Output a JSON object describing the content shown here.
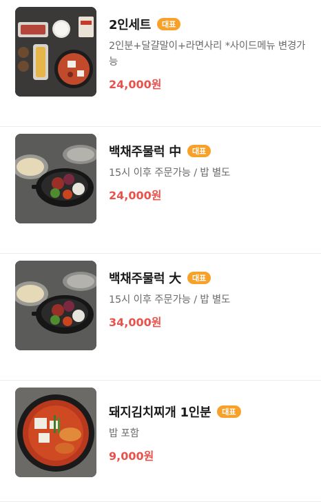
{
  "menu": {
    "items": [
      {
        "name": "2인세트",
        "badge": "대표",
        "description": "2인분+달걀말이+라면사리 *사이드메뉴 변경가능",
        "price": "24,000원",
        "image_icon": "jjigae-set-photo"
      },
      {
        "name": "백채주물럭 中",
        "badge": "대표",
        "description": "15시 이후 주문가능 / 밥 별도",
        "price": "24,000원",
        "image_icon": "jumulleok-pan-photo"
      },
      {
        "name": "백채주물럭 大",
        "badge": "대표",
        "description": "15시 이후 주문가능 / 밥 별도",
        "price": "34,000원",
        "image_icon": "jumulleok-pan-photo"
      },
      {
        "name": "돼지김치찌개 1인분",
        "badge": "대표",
        "description": "밥 포함",
        "price": "9,000원",
        "image_icon": "kimchi-jjigae-pot-photo"
      }
    ]
  },
  "colors": {
    "badge": "#f7a12a",
    "price": "#e8524c",
    "divider": "#ececec"
  }
}
